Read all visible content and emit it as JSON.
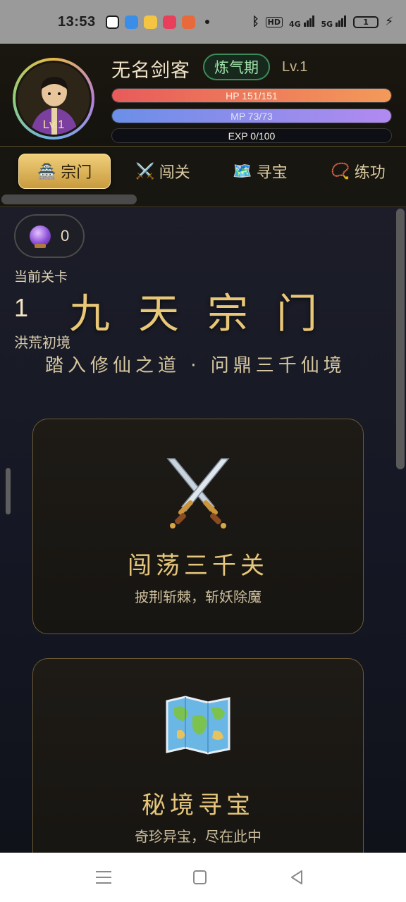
{
  "status_bar": {
    "time": "13:53",
    "app_icon_colors": [
      "#ffffff",
      "#3a8ee8",
      "#f4c542",
      "#e8405a",
      "#e86a3a"
    ],
    "network_hd": "HD",
    "network_4g": "4G",
    "network_5g": "5G",
    "battery": "1"
  },
  "player": {
    "avatar_level": "Lv.1",
    "name": "无名剑客",
    "realm": "炼气期",
    "level": "Lv.1",
    "hp": {
      "label": "HP 151/151",
      "fraction": 1.0
    },
    "mp": {
      "label": "MP 73/73",
      "fraction": 1.0
    },
    "exp": {
      "label": "EXP 0/100",
      "fraction": 0.0
    }
  },
  "tabs": [
    {
      "icon": "temple-icon",
      "label": "宗门",
      "active": true
    },
    {
      "icon": "crossed-swords-icon",
      "label": "闯关",
      "active": false
    },
    {
      "icon": "map-icon",
      "label": "寻宝",
      "active": false
    },
    {
      "icon": "prayer-beads-icon",
      "label": "练功",
      "active": false
    }
  ],
  "currency": {
    "icon": "crystal-ball-icon",
    "value": "0"
  },
  "stage": {
    "label": "当前关卡",
    "number": "1",
    "title": "九天宗门",
    "realm_name": "洪荒初境",
    "motto": "踏入修仙之道 · 问鼎三千仙境"
  },
  "cards": [
    {
      "icon": "crossed-swords-icon",
      "title": "闯荡三千关",
      "subtitle": "披荆斩棘，斩妖除魔"
    },
    {
      "icon": "world-map-icon",
      "title": "秘境寻宝",
      "subtitle": "奇珍异宝，尽在此中"
    }
  ],
  "colors": {
    "accent_gold": "#e8c777",
    "hp": "#e85b5b",
    "mp": "#8f8cef",
    "realm_green": "#9fe0a8"
  }
}
